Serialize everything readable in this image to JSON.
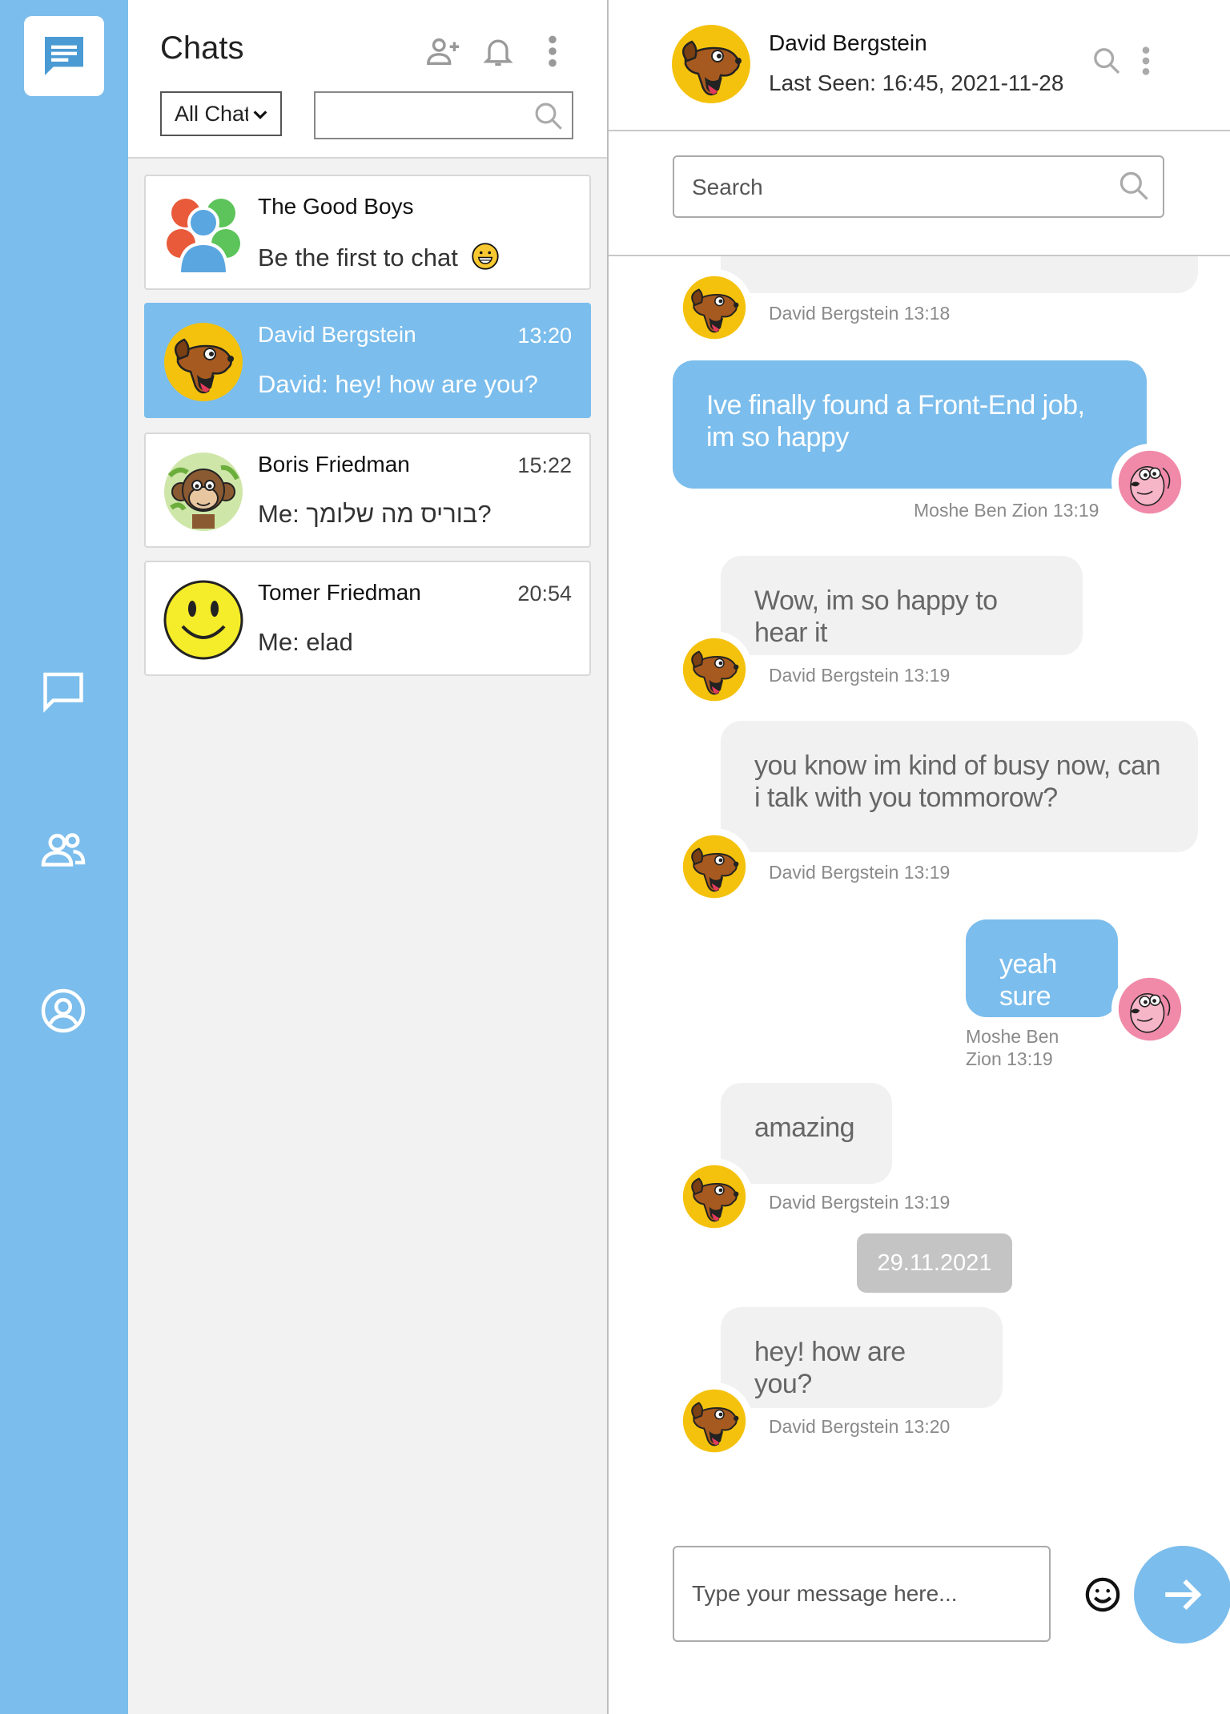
{
  "rail": {
    "logo_icon": "chat-logo-icon",
    "items": [
      {
        "icon": "chat-bubble-icon"
      },
      {
        "icon": "contacts-icon"
      },
      {
        "icon": "profile-icon"
      }
    ]
  },
  "chat_list": {
    "title": "Chats",
    "filter": {
      "selected": "All Chats"
    },
    "search": {
      "placeholder": ""
    },
    "items": [
      {
        "name": "The Good Boys",
        "time": "",
        "preview": "Be the first to chat",
        "avatar": "group-avatar",
        "emoji": "grinning-face-icon"
      },
      {
        "name": "David Bergstein",
        "time": "13:20",
        "preview": "David: hey! how are you?",
        "avatar": "dog-avatar"
      },
      {
        "name": "Boris Friedman",
        "time": "15:22",
        "preview": "Me: בוריס מה שלומך?",
        "avatar": "monkey-avatar"
      },
      {
        "name": "Tomer Friedman",
        "time": "20:54",
        "preview": "Me: elad",
        "avatar": "smiley-avatar"
      }
    ]
  },
  "conversation": {
    "contact_name": "David Bergstein",
    "last_seen": "Last Seen: 16:45, 2021-11-28",
    "search_placeholder": "Search",
    "messages": [
      {
        "from": "in",
        "text": "",
        "meta": "David Bergstein 13:18"
      },
      {
        "from": "out",
        "text": "Ive finally found a Front-End job, im so happy",
        "meta": "Moshe Ben Zion 13:19"
      },
      {
        "from": "in",
        "text": "Wow, im so happy to hear it",
        "meta": "David Bergstein 13:19"
      },
      {
        "from": "in",
        "text": "you know im kind of busy now, can i talk with you tommorow?",
        "meta": "David Bergstein 13:19"
      },
      {
        "from": "out",
        "text": "yeah sure",
        "meta": "Moshe Ben Zion 13:19"
      },
      {
        "from": "in",
        "text": "amazing",
        "meta": "David Bergstein 13:19"
      },
      {
        "from": "in",
        "text": "hey! how are you?",
        "meta": "David Bergstein 13:20"
      }
    ],
    "date_divider": "29.11.2021",
    "composer_placeholder": "Type your message here..."
  },
  "colors": {
    "accent": "#7bbdec",
    "bubble_incoming": "#f1f1f1",
    "list_background": "#f2f2f2",
    "date_pill": "#c4c4c4"
  }
}
